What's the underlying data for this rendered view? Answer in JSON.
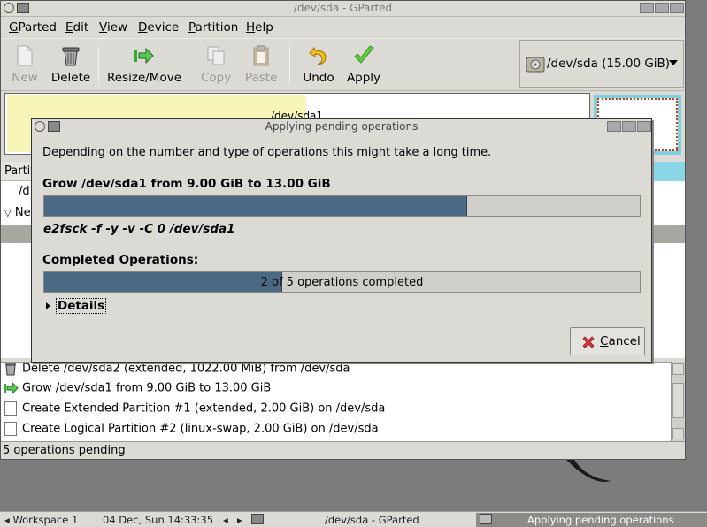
{
  "window": {
    "title": "/dev/sda - GParted"
  },
  "menu": {
    "items": [
      {
        "label": "GParted",
        "accel": "G",
        "rest": "Parted"
      },
      {
        "label": "Edit",
        "accel": "E",
        "rest": "dit"
      },
      {
        "label": "View",
        "accel": "V",
        "rest": "iew"
      },
      {
        "label": "Device",
        "accel": "D",
        "rest": "evice"
      },
      {
        "label": "Partition",
        "accel": "P",
        "rest": "artition"
      },
      {
        "label": "Help",
        "accel": "H",
        "rest": "elp"
      }
    ]
  },
  "toolbar": {
    "new": "New",
    "delete": "Delete",
    "resize": "Resize/Move",
    "copy": "Copy",
    "paste": "Paste",
    "undo": "Undo",
    "apply": "Apply"
  },
  "device": {
    "label": "/dev/sda  (15.00 GiB)"
  },
  "strip": {
    "p1_label": "/dev/sda1"
  },
  "table": {
    "header": "Partiti",
    "row1": "/d",
    "row2": "Ne"
  },
  "operations": [
    {
      "text": "Delete /dev/sda2 (extended, 1022.00 MiB) from /dev/sda",
      "icon": "trash-icon"
    },
    {
      "text": "Grow /dev/sda1 from 9.00 GiB to 13.00 GiB",
      "icon": "resize-icon"
    },
    {
      "text": "Create Extended Partition #1 (extended, 2.00 GiB) on /dev/sda",
      "icon": "new-doc-icon"
    },
    {
      "text": "Create Logical Partition #2 (linux-swap, 2.00 GiB) on /dev/sda",
      "icon": "new-doc-icon"
    }
  ],
  "status": {
    "text": "5 operations pending"
  },
  "dialog": {
    "title": "Applying pending operations",
    "message": "Depending on the number and type of operations this might take a long time.",
    "current_op": "Grow /dev/sda1 from 9.00 GiB to 13.00 GiB",
    "current_progress": 0.71,
    "command": "e2fsck -f -y -v -C 0 /dev/sda1",
    "completed_label": "Completed Operations:",
    "completed_progress": 0.4,
    "completed_text": "2 of 5 operations completed",
    "details_label": "Details",
    "cancel_label": "Cancel",
    "cancel_accel": "C",
    "cancel_rest": "ancel"
  },
  "taskbar": {
    "workspace": "Workspace 1",
    "datetime": "04 Dec, Sun 14:33:35",
    "task1": "/dev/sda - GParted",
    "task2": "Applying pending operations"
  },
  "colors": {
    "progress_fill": "#4b6983",
    "partition_yellow": "#f7f6b8",
    "swap_cyan": "#7ed0e0"
  }
}
